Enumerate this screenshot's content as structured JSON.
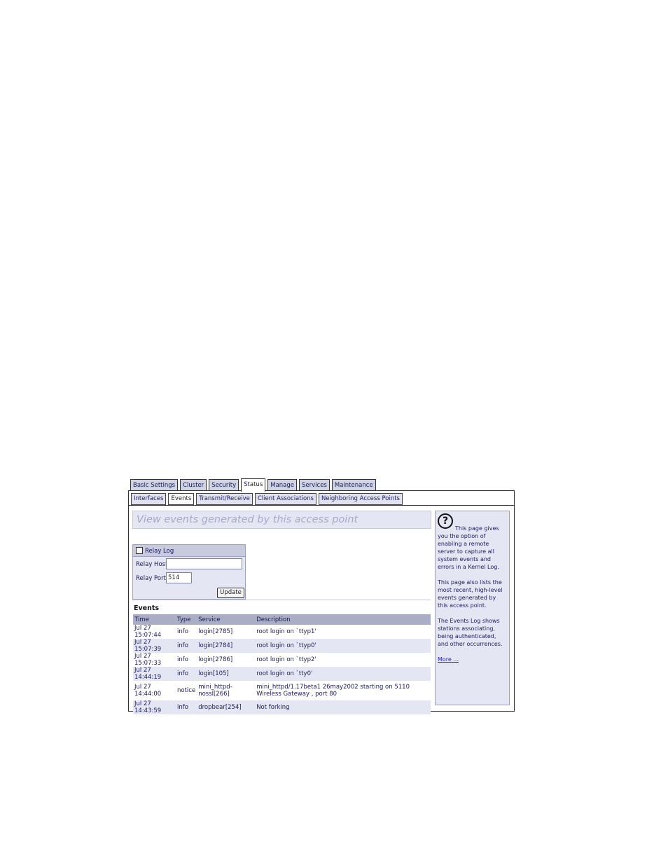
{
  "main_tabs": [
    "Basic Settings",
    "Cluster",
    "Security",
    "Status",
    "Manage",
    "Services",
    "Maintenance"
  ],
  "sub_tabs": [
    "Interfaces",
    "Events",
    "Transmit/Receive",
    "Client Associations",
    "Neighboring Access Points"
  ],
  "banner": "View events generated by this access point",
  "relay": {
    "checkbox_label": "Relay Log",
    "host_label": "Relay Host",
    "host_value": "",
    "port_label": "Relay Port",
    "port_value": "514",
    "update_label": "Update"
  },
  "events": {
    "title": "Events",
    "columns": [
      "Time",
      "Type",
      "Service",
      "Description"
    ],
    "rows": [
      {
        "time": "Jul 27 15:07:44",
        "type": "info",
        "service": "login[2785]",
        "description": "root login on `ttyp1'"
      },
      {
        "time": "Jul 27 15:07:39",
        "type": "info",
        "service": "login[2784]",
        "description": "root login on `ttyp0'"
      },
      {
        "time": "Jul 27 15:07:33",
        "type": "info",
        "service": "login[2786]",
        "description": "root login on `ttyp2'"
      },
      {
        "time": "Jul 27 14:44:19",
        "type": "info",
        "service": "login[105]",
        "description": "root login on `tty0'"
      },
      {
        "time": "Jul 27 14:44:00",
        "type": "notice",
        "service": "mini_httpd-nossl[266]",
        "description": "mini_httpd/1.17beta1 26may2002 starting on 5110 Wireless Gateway , port 80"
      },
      {
        "time": "Jul 27 14:43:59",
        "type": "info",
        "service": "dropbear[254]",
        "description": "Not forking"
      }
    ]
  },
  "help": {
    "icon": "question-icon",
    "p1": "This page gives you the option of enabling a remote server to capture all system events and errors in a Kernel Log.",
    "p2": "This page also lists the most recent, high-level events generated by this access point.",
    "p3": "The Events Log shows stations associating, being authenticated, and other occurrences.",
    "more": "More ..."
  }
}
